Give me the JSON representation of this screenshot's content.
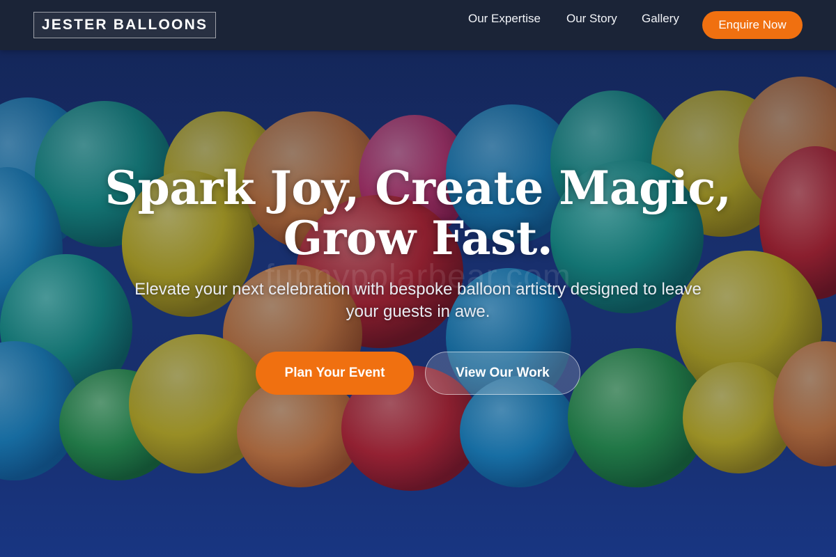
{
  "header": {
    "logo": "JESTER BALLOONS",
    "nav": [
      {
        "label": "Our Expertise"
      },
      {
        "label": "Our Story"
      },
      {
        "label": "Gallery"
      }
    ],
    "cta_label": "Enquire Now"
  },
  "hero": {
    "headline_line1": "Spark Joy, Create Magic,",
    "headline_line2": "Grow Fast.",
    "subheadline": "Elevate your next celebration with bespoke balloon artistry designed to leave your guests in awe.",
    "primary_button": "Plan Your Event",
    "secondary_button": "View Our Work",
    "background_image": "colorful-balloons-arch"
  },
  "watermark": "funnypolarbear.com",
  "colors": {
    "accent": "#f07010",
    "header_bg": "#1c2436",
    "sky": "#1c3a8a",
    "balloon_blue": "#1a9ad6",
    "balloon_teal": "#19b3a0",
    "balloon_yellow": "#e8d21a",
    "balloon_orange": "#f08a3a",
    "balloon_pink": "#e63a78",
    "balloon_red": "#d8232a",
    "balloon_green": "#2aa84a"
  }
}
